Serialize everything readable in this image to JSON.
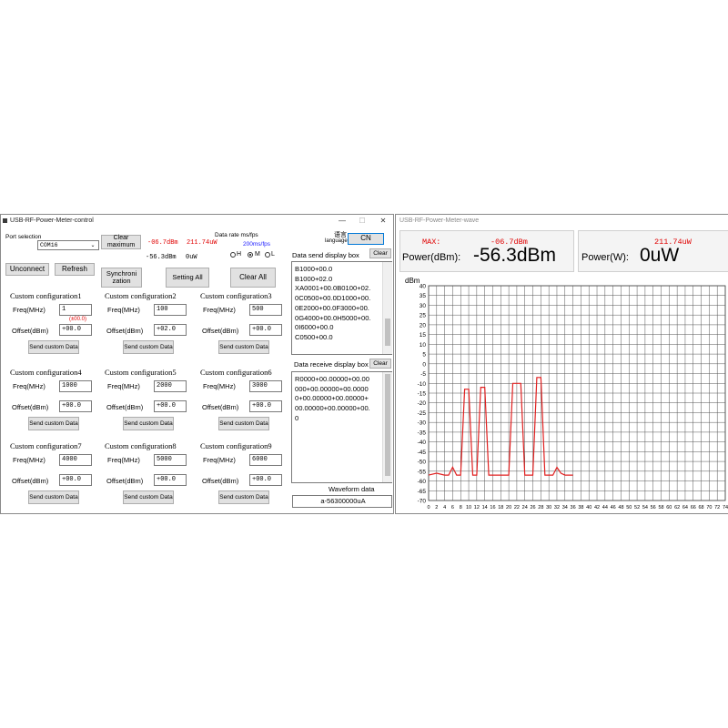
{
  "control": {
    "title": "USB-RF-Power-Meter-control",
    "port_label": "Port selection",
    "port_value": "COM16",
    "clear_max_label": "Clear maximum",
    "max_dbm": "-06.7dBm",
    "max_uw": "211.74uW",
    "cur_dbm": "-56.3dBm",
    "cur_uw": "0uW",
    "rate_label": "Data rate ms/fps",
    "rate_value": "200ms/fps",
    "radio_h": "H",
    "radio_m": "M",
    "radio_l": "L",
    "lang_label": "语言",
    "lang_sub": "language",
    "lang_btn": "CN",
    "unconnect": "Unconnect",
    "refresh": "Refresh",
    "sync": "Synchroni zation",
    "setting": "Setting All",
    "clear_all": "Clear All",
    "freq_label": "Freq(MHz)",
    "offset_label": "Offset(dBm)",
    "send_label": "Send custom Data",
    "hint": "(±00.0)",
    "configs": [
      {
        "title": "Custom configuration1",
        "freq": "1",
        "offset": "+00.0"
      },
      {
        "title": "Custom configuration2",
        "freq": "100",
        "offset": "+02.0"
      },
      {
        "title": "Custom configuration3",
        "freq": "500",
        "offset": "+00.0"
      },
      {
        "title": "Custom configuration4",
        "freq": "1000",
        "offset": "+00.0"
      },
      {
        "title": "Custom configuration5",
        "freq": "2000",
        "offset": "+00.0"
      },
      {
        "title": "Custom configuration6",
        "freq": "3000",
        "offset": "+00.0"
      },
      {
        "title": "Custom configuration7",
        "freq": "4000",
        "offset": "+00.0"
      },
      {
        "title": "Custom configuration8",
        "freq": "5000",
        "offset": "+00.0"
      },
      {
        "title": "Custom configuration9",
        "freq": "6000",
        "offset": "+00.0"
      }
    ],
    "send_box_label": "Data send display box",
    "clear_label": "Clear",
    "send_lines": [
      "B1000+00.0",
      "B1000+02.0",
      "XA0001+00.0B0100+02.",
      "0C0500+00.0D1000+00.",
      "0E2000+00.0F3000+00.",
      "0G4000+00.0H5000+00.",
      "0I6000+00.0",
      "C0500+00.0"
    ],
    "recv_box_label": "Data receive display box",
    "recv_lines": [
      "R0000+00.00000+00.00",
      "000+00.00000+00.0000",
      "0+00.00000+00.00000+",
      "00.00000+00.00000+00.",
      "0"
    ],
    "waveform_label": "Waveform data",
    "waveform_value": "a-56300000uA"
  },
  "wave": {
    "title": "USB-RF-Power-Meter-wave",
    "max_label": "MAX:",
    "max_dbm": "-06.7dBm",
    "max_uw": "211.74uW",
    "power_dbm_label": "Power(dBm):",
    "power_dbm": "-56.3dBm",
    "power_w_label": "Power(W):",
    "power_w": "0uW"
  },
  "colors": {
    "accent_red": "#e00000",
    "line_red": "#e02020",
    "blue_text": "#1a1aff"
  },
  "chart_data": {
    "type": "line",
    "ylabel": "dBm",
    "ylim": [
      -70,
      40
    ],
    "yticks": [
      40,
      35,
      30,
      25,
      20,
      15,
      10,
      5,
      0,
      -5,
      -10,
      -15,
      -20,
      -25,
      -30,
      -35,
      -40,
      -45,
      -50,
      -55,
      -60,
      -65,
      -70
    ],
    "xlim": [
      0,
      74
    ],
    "xticks": [
      0,
      2,
      4,
      6,
      8,
      10,
      12,
      14,
      16,
      18,
      20,
      22,
      24,
      26,
      28,
      30,
      32,
      34,
      36,
      38,
      40,
      42,
      44,
      46,
      48,
      50,
      52,
      54,
      56,
      58,
      60,
      62,
      64,
      66,
      68,
      70,
      72,
      74
    ],
    "grid": true,
    "series": [
      {
        "x": [
          0,
          2,
          4,
          5,
          6,
          7,
          8,
          9,
          10,
          11,
          12,
          13,
          14,
          15,
          16,
          17,
          18,
          19,
          20,
          21,
          22,
          23,
          24,
          25,
          26,
          27,
          28,
          29,
          30,
          31,
          32,
          33,
          34,
          35,
          36
        ],
        "y": [
          -57,
          -56,
          -57,
          -57,
          -53,
          -57,
          -57,
          -13,
          -13,
          -57,
          -57,
          -12,
          -12,
          -57,
          -57,
          -57,
          -57,
          -57,
          -57,
          -10,
          -10,
          -10,
          -57,
          -57,
          -57,
          -7,
          -7,
          -57,
          -57,
          -57,
          -53,
          -56,
          -57,
          -57,
          -57
        ]
      }
    ]
  }
}
